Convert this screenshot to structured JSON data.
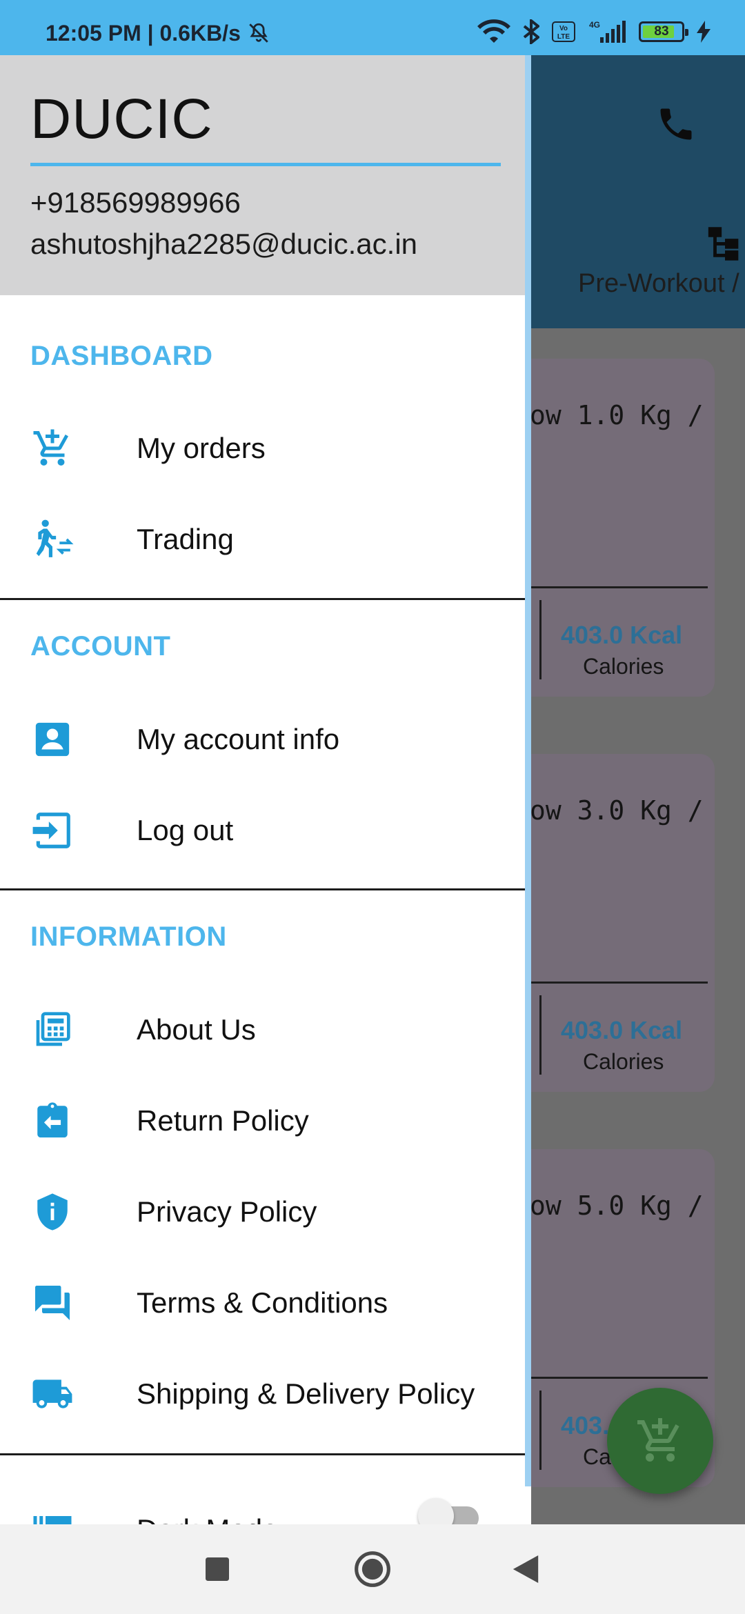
{
  "status_bar": {
    "time": "12:05 PM",
    "speed": "0.6KB/s",
    "battery_level": "83",
    "battery_fraction": 0.83,
    "icons": [
      "mute-icon",
      "wifi-icon",
      "bluetooth-icon",
      "volte-icon",
      "signal-icon",
      "battery-icon",
      "charging-icon"
    ]
  },
  "background_app": {
    "header_label": "Pre-Workout /",
    "header_icons": [
      "phone-icon",
      "tree-icon"
    ],
    "cards": [
      {
        "weight": "ow 1.0 Kg /",
        "kcal": "403.0 Kcal",
        "cal_label": "Calories"
      },
      {
        "weight": "ow 3.0 Kg /",
        "kcal": "403.0 Kcal",
        "cal_label": "Calories"
      },
      {
        "weight": "ow 5.0 Kg /",
        "kcal": "403.",
        "cal_label": "Ca"
      }
    ],
    "fab_icon": "add-to-cart-icon"
  },
  "drawer": {
    "brand": "DUCIC",
    "phone": "+918569989966",
    "email": "ashutoshjha2285@ducic.ac.in",
    "sections": {
      "dashboard": {
        "title": "DASHBOARD",
        "items": [
          {
            "label": "My orders",
            "icon": "add-to-cart-icon"
          },
          {
            "label": "Trading",
            "icon": "trading-icon"
          }
        ]
      },
      "account": {
        "title": "ACCOUNT",
        "items": [
          {
            "label": "My account info",
            "icon": "account-icon"
          },
          {
            "label": "Log out",
            "icon": "logout-icon"
          }
        ]
      },
      "information": {
        "title": "INFORMATION",
        "items": [
          {
            "label": "About Us",
            "icon": "calculator-icon"
          },
          {
            "label": "Return Policy",
            "icon": "return-icon"
          },
          {
            "label": "Privacy Policy",
            "icon": "shield-icon"
          },
          {
            "label": "Terms & Conditions",
            "icon": "chat-icon"
          },
          {
            "label": "Shipping & Delivery Policy",
            "icon": "truck-icon"
          }
        ]
      },
      "settings": {
        "items": [
          {
            "label": "Dark Mode",
            "icon": "gallery-icon",
            "toggle": false
          }
        ]
      }
    }
  },
  "colors": {
    "accent": "#4db6ec",
    "icon": "#1e9bd7",
    "header_dark": "#1f4a64",
    "kcal": "#2d6f96",
    "fab": "#2f6a33"
  },
  "nav_bar": {
    "buttons": [
      "recents-button",
      "home-button",
      "back-button"
    ]
  }
}
